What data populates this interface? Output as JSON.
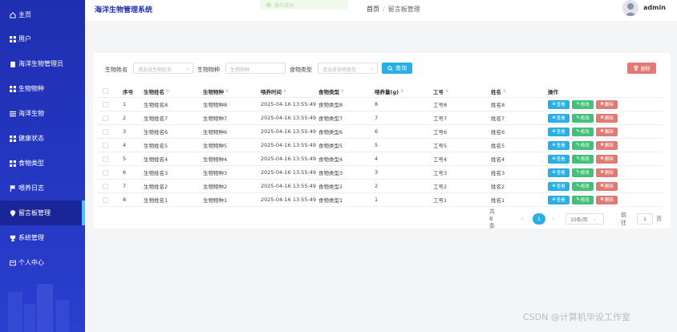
{
  "app": {
    "title": "海洋生物管理系统"
  },
  "toast": {
    "text": "操作成功"
  },
  "breadcrumb": {
    "home": "首页",
    "sep": "/",
    "current": "留言板管理"
  },
  "user": {
    "name": "admin"
  },
  "sidebar": {
    "items": [
      {
        "label": "主页",
        "icon": "home-icon"
      },
      {
        "label": "用户",
        "icon": "grid-icon"
      },
      {
        "label": "海洋生物管理员",
        "icon": "clipboard-icon"
      },
      {
        "label": "生物物种",
        "icon": "grid-icon"
      },
      {
        "label": "海洋生物",
        "icon": "list-icon"
      },
      {
        "label": "健康状态",
        "icon": "grid-icon"
      },
      {
        "label": "食物类型",
        "icon": "grid-icon"
      },
      {
        "label": "喂养日志",
        "icon": "flag-icon"
      },
      {
        "label": "留言板管理",
        "icon": "location-icon"
      },
      {
        "label": "系统管理",
        "icon": "trophy-icon"
      },
      {
        "label": "个人中心",
        "icon": "id-card-icon"
      }
    ],
    "active_index": 8
  },
  "search": {
    "name_label": "生物姓名",
    "name_placeholder": "请选择生物姓名",
    "species_label": "生物物种",
    "species_placeholder": "生物物种",
    "food_label": "食物类型",
    "food_placeholder": "请选择食物类型",
    "search_button": "查询",
    "delete_button": "删除"
  },
  "table": {
    "headers": [
      "序号",
      "生物姓名",
      "生物物种",
      "喂养时间",
      "食物类型",
      "喂养量(g)",
      "工号",
      "姓名",
      "操作"
    ],
    "rows": [
      [
        "1",
        "生物姓名8",
        "生物物种8",
        "2025-04-16 13:55:49",
        "食物类型8",
        "8",
        "工号8",
        "姓名8"
      ],
      [
        "2",
        "生物姓名7",
        "生物物种7",
        "2025-04-16 13:55:49",
        "食物类型7",
        "7",
        "工号7",
        "姓名7"
      ],
      [
        "3",
        "生物姓名6",
        "生物物种6",
        "2025-04-16 13:55:49",
        "食物类型6",
        "6",
        "工号6",
        "姓名6"
      ],
      [
        "4",
        "生物姓名5",
        "生物物种5",
        "2025-04-16 13:55:49",
        "食物类型5",
        "5",
        "工号5",
        "姓名5"
      ],
      [
        "5",
        "生物姓名4",
        "生物物种4",
        "2025-04-16 13:55:49",
        "食物类型4",
        "4",
        "工号4",
        "姓名4"
      ],
      [
        "6",
        "生物姓名3",
        "生物物种3",
        "2025-04-16 13:55:49",
        "食物类型3",
        "3",
        "工号3",
        "姓名3"
      ],
      [
        "7",
        "生物姓名2",
        "生物物种2",
        "2025-04-16 13:55:49",
        "食物类型2",
        "2",
        "工号2",
        "姓名2"
      ],
      [
        "8",
        "生物姓名1",
        "生物物种1",
        "2025-04-16 13:55:49",
        "食物类型1",
        "1",
        "工号1",
        "姓名1"
      ]
    ],
    "actions": {
      "view": "查看",
      "edit": "修改",
      "delete": "删除"
    }
  },
  "pagination": {
    "total": "共 8 条",
    "prev": "‹",
    "current": "1",
    "next": "›",
    "page_size": "10条/页",
    "goto_label": "前往",
    "goto_value": "1",
    "page_unit": "页"
  },
  "watermark": "CSDN @计算机毕设工作室",
  "colors": {
    "sidebar": "#2538c3",
    "primary": "#29aee6",
    "success": "#43c07a",
    "danger": "#e07b74"
  }
}
